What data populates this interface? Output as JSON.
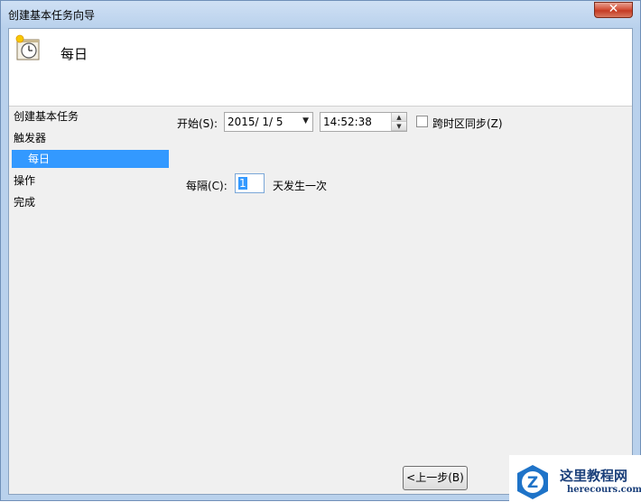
{
  "window": {
    "title": "创建基本任务向导",
    "close_symbol": "✕"
  },
  "header": {
    "title": "每日",
    "icon": "calendar-clock-icon"
  },
  "nav": {
    "items": [
      {
        "label": "创建基本任务"
      },
      {
        "label": "触发器"
      },
      {
        "label": "每日",
        "selected": true
      },
      {
        "label": "操作"
      },
      {
        "label": "完成"
      }
    ]
  },
  "form": {
    "start_label": "开始(S):",
    "start_date": "2015/  1/  5",
    "start_time": "14:52:38",
    "sync_tz_label": "跨时区同步(Z)",
    "sync_tz_checked": false,
    "recur_label": "每隔(C):",
    "recur_value": "1",
    "recur_suffix": "天发生一次"
  },
  "footer": {
    "back_label": "<上一步(B)"
  },
  "watermark": {
    "cn": "这里教程网",
    "en": "herecours.com"
  },
  "colors": {
    "selection": "#3399ff",
    "close": "#c43b23"
  }
}
